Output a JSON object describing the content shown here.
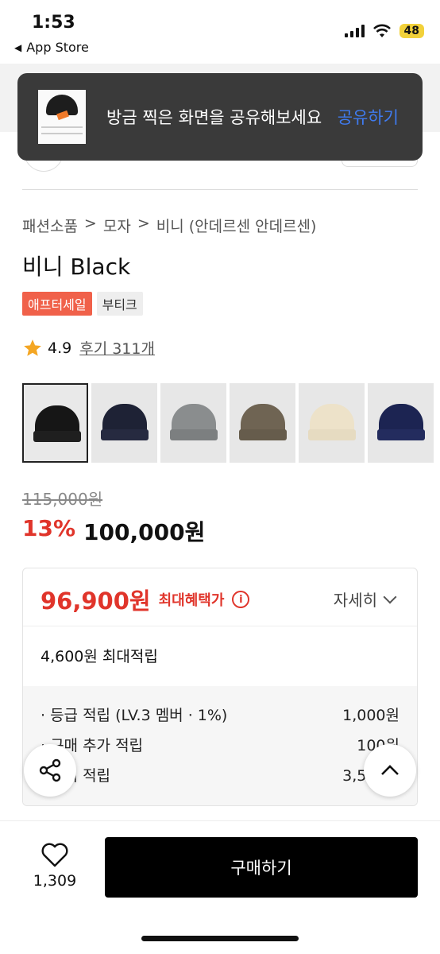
{
  "status": {
    "time": "1:53",
    "back_app": "App Store",
    "battery": "48"
  },
  "toast": {
    "message": "방금 찍은 화면을 공유해보세요",
    "action": "공유하기"
  },
  "breadcrumb": {
    "items": [
      "패션소품",
      "모자",
      "비니 (안데르센 안데르센)"
    ],
    "separator": ">"
  },
  "product": {
    "title": "비니 Black",
    "tags": [
      "애프터세일",
      "부티크"
    ],
    "rating": "4.9",
    "reviews": "후기 311개",
    "swatches": [
      {
        "color": "#161616",
        "cuff": "#1f1f1f"
      },
      {
        "color": "#1e2235",
        "cuff": "#262a40"
      },
      {
        "color": "#8a8d8e",
        "cuff": "#7c7f80"
      },
      {
        "color": "#6f6453",
        "cuff": "#665c4c"
      },
      {
        "color": "#ede2c9",
        "cuff": "#e6dbc1"
      },
      {
        "color": "#1c2452",
        "cuff": "#232c5e"
      }
    ]
  },
  "price": {
    "original": "115,000원",
    "discount": "13%",
    "current": "100,000원"
  },
  "benefit": {
    "max_price": "96,900원",
    "max_label": "최대혜택가",
    "detail": "자세히",
    "points_total": "4,600원 최대적립",
    "lines": [
      {
        "label": "· 등급 적립 (LV.3 멤버 · 1%)",
        "value": "1,000원"
      },
      {
        "label": "· 구매 추가 적립",
        "value": "100원"
      },
      {
        "label": "· 후기 적립",
        "value": "3,500원"
      }
    ]
  },
  "bottom": {
    "likes": "1,309",
    "buy_label": "구매하기"
  },
  "colors": {
    "accent_red": "#e0352b",
    "toast_link": "#3f7bf0",
    "sale_tag": "#f0614a"
  }
}
